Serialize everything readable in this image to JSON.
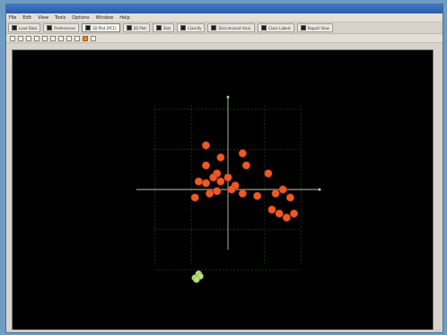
{
  "window": {
    "title": ""
  },
  "menu": {
    "items": [
      "File",
      "Edit",
      "View",
      "Tools",
      "Options",
      "Window",
      "Help"
    ]
  },
  "tabs": [
    {
      "label": "Load Data"
    },
    {
      "label": "Preferences"
    },
    {
      "label": "3D Plot (PC1)",
      "active": true
    },
    {
      "label": "2D Plot"
    },
    {
      "label": "Stat"
    },
    {
      "label": "Classify"
    },
    {
      "label": "Discriminant Anal."
    },
    {
      "label": "Class Labels"
    },
    {
      "label": "Report View"
    }
  ],
  "toolbar": {
    "tools": [
      "zoom-in",
      "zoom-out",
      "rotate",
      "pan",
      "reset",
      "select",
      "label",
      "copy",
      "print",
      "color",
      "settings"
    ]
  },
  "plot": {
    "colors": {
      "background": "#000000",
      "axis": "#b9c4b0",
      "grid": "#3f6a3a",
      "cluster_a": "#ee5a26",
      "cluster_b": "#b7e07a"
    },
    "cluster_a": [
      [
        -0.3,
        0.55
      ],
      [
        -0.1,
        0.4
      ],
      [
        -0.3,
        0.3
      ],
      [
        -0.15,
        0.2
      ],
      [
        0.2,
        0.45
      ],
      [
        0.25,
        0.3
      ],
      [
        -0.4,
        0.1
      ],
      [
        -0.3,
        0.08
      ],
      [
        -0.2,
        0.15
      ],
      [
        -0.1,
        0.1
      ],
      [
        0.0,
        0.15
      ],
      [
        0.1,
        0.05
      ],
      [
        -0.25,
        -0.05
      ],
      [
        -0.15,
        -0.02
      ],
      [
        0.05,
        0.0
      ],
      [
        -0.45,
        -0.1
      ],
      [
        0.2,
        -0.05
      ],
      [
        0.4,
        -0.08
      ],
      [
        0.55,
        0.2
      ],
      [
        0.65,
        -0.05
      ],
      [
        0.75,
        0.0
      ],
      [
        0.85,
        -0.1
      ],
      [
        0.6,
        -0.25
      ],
      [
        0.7,
        -0.3
      ],
      [
        0.8,
        -0.35
      ],
      [
        0.9,
        -0.3
      ]
    ],
    "cluster_b": [
      [
        -0.45,
        -1.1
      ],
      [
        -0.4,
        -1.05
      ],
      [
        -0.38,
        -1.08
      ],
      [
        -0.43,
        -1.12
      ]
    ]
  }
}
